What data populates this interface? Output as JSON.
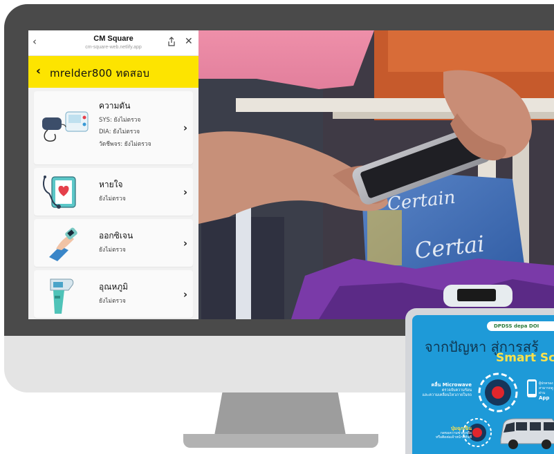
{
  "browser": {
    "title": "CM Square",
    "url": "cm-square-web.netlify.app",
    "back_glyph": "‹",
    "close_glyph": "✕"
  },
  "app": {
    "header_back_glyph": "‹",
    "header_title": "mrelder800 ทดสอบ",
    "cards": [
      {
        "title": "ความดัน",
        "lines": [
          "SYS: ยังไม่ตรวจ",
          "DIA: ยังไม่ตรวจ",
          "วัดชีพจร: ยังไม่ตรวจ"
        ],
        "icon": "blood-pressure-monitor-icon"
      },
      {
        "title": "หายใจ",
        "lines": [
          "ยังไม่ตรวจ"
        ],
        "icon": "stethoscope-heart-icon"
      },
      {
        "title": "ออกซิเจน",
        "lines": [
          "ยังไม่ตรวจ"
        ],
        "icon": "pulse-oximeter-icon"
      },
      {
        "title": "อุณหภูมิ",
        "lines": [
          "ยังไม่ตรวจ"
        ],
        "icon": "infrared-thermometer-icon"
      }
    ],
    "chevron_glyph": "›"
  },
  "tablet": {
    "logos": "DPDSS  depa  DOI",
    "title": "จากปัญหา สู่การสร้",
    "subtitle": "Smart Sch",
    "microwave_title": "คลื่น Microwave",
    "microwave_line1": "ตรวจจับความร้อน",
    "microwave_line2": "และความเคลื่อนไหวภายในรถ",
    "button_title": "ปุ่มฉุกเฉิน",
    "button_line1": "กดขอความช่วยเหลือ",
    "button_line2": "หรือติดต่อเจ้าหน้าที่ทันที",
    "app_line": "ผู้ปกครอง",
    "app_line2": "สามารถดูผ่าน",
    "app_title": "App"
  },
  "colors": {
    "app_bar": "#fde400",
    "bezel": "#4a4a4a",
    "monitor_chin": "#e4e4e4",
    "poster_blue": "#1e9ad8",
    "poster_yellow": "#ffe24a"
  }
}
